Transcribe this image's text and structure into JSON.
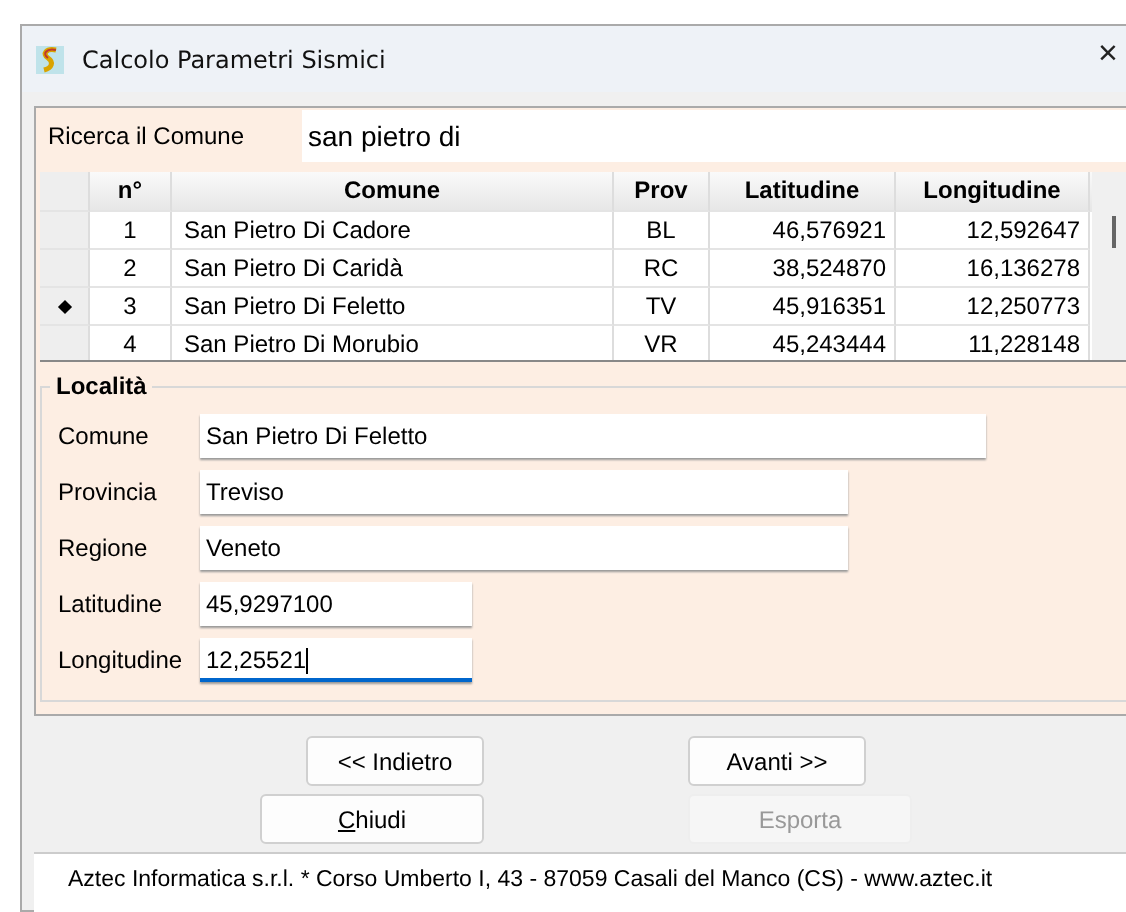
{
  "window": {
    "title": "Calcolo Parametri Sismici",
    "close": "×"
  },
  "search": {
    "label": "Ricerca il Comune",
    "value": "san pietro di"
  },
  "table": {
    "columns": [
      "n°",
      "Comune",
      "Prov",
      "Latitudine",
      "Longitudine"
    ],
    "rows": [
      {
        "cells": [
          "1",
          "San Pietro Di Cadore",
          "BL",
          "46,576921",
          "12,592647"
        ],
        "selected": false
      },
      {
        "cells": [
          "2",
          "San Pietro Di Caridà",
          "RC",
          "38,524870",
          "16,136278"
        ],
        "selected": false
      },
      {
        "cells": [
          "3",
          "San Pietro Di Feletto",
          "TV",
          "45,916351",
          "12,250773"
        ],
        "selected": true
      },
      {
        "cells": [
          "4",
          "San Pietro Di Morubio",
          "VR",
          "45,243444",
          "11,228148"
        ],
        "selected": false
      }
    ]
  },
  "localita": {
    "title": "Località",
    "fields": [
      {
        "label": "Comune",
        "value": "San Pietro Di Feletto",
        "focused": false
      },
      {
        "label": "Provincia",
        "value": "Treviso",
        "focused": false
      },
      {
        "label": "Regione",
        "value": "Veneto",
        "focused": false
      },
      {
        "label": "Latitudine",
        "value": "45,9297100",
        "focused": false
      },
      {
        "label": "Longitudine",
        "value": "12,25521",
        "focused": true
      }
    ]
  },
  "buttons": [
    [
      {
        "label": "<< Indietro",
        "disabled": false,
        "underline_first": false
      },
      {
        "label": "Avanti  >>",
        "disabled": false,
        "underline_first": false
      }
    ],
    [
      {
        "label": "Chiudi",
        "disabled": false,
        "underline_first": true
      },
      {
        "label": "Esporta",
        "disabled": true,
        "underline_first": false
      }
    ]
  ],
  "status_bar": "Aztec Informatica s.r.l. * Corso Umberto I, 43 - 87059 Casali del Manco (CS) - www.aztec.it"
}
